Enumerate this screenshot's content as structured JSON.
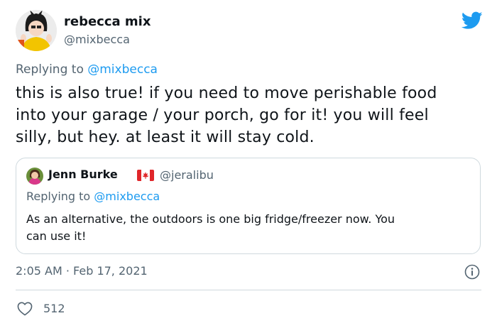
{
  "tweet": {
    "author_name": "rebecca mix",
    "author_handle": "@mixbecca",
    "reply_prefix": "Replying to",
    "reply_mention": "@mixbecca",
    "text_lines": [
      "this is also true! if you need to move perishable food",
      "into your garage / your porch, go for it! you will feel",
      "silly, but hey. at least it will stay cold."
    ],
    "timestamp": "2:05 AM · Feb 17, 2021",
    "like_count": "512"
  },
  "quoted_tweet": {
    "author_name": "Jenn Burke",
    "flag_icon": "canada-flag-icon",
    "author_handle": "@jeralibu",
    "reply_prefix": "Replying to",
    "reply_mention": "@mixbecca",
    "text_lines": [
      "As an alternative, the outdoors is one big fridge/freezer now. You",
      "can use it!"
    ]
  },
  "icons": {
    "logo": "twitter-bird-icon",
    "info": "info-icon",
    "like": "heart-icon"
  },
  "colors": {
    "accent": "#1d9bf0",
    "text": "#0f1419",
    "secondary": "#536471",
    "border": "#cfd9de"
  }
}
